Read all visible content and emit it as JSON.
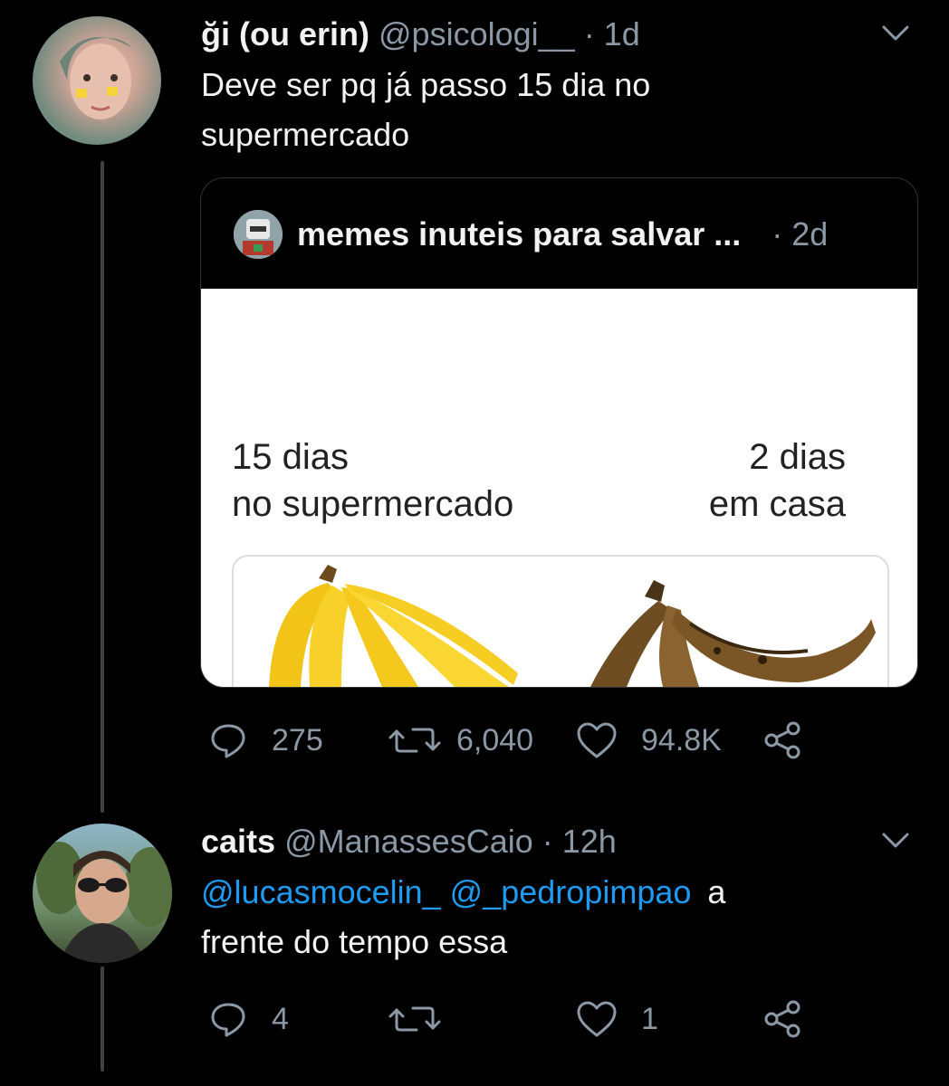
{
  "tweet1": {
    "display_name": "ği (ou erin)",
    "handle": "@psicologi__",
    "time": "· 1d",
    "text_line1": "Deve ser pq já passo 15 dia no",
    "text_line2": "supermercado",
    "quote": {
      "display_name": "memes inuteis para salvar ...",
      "time": "· 2d",
      "meme": {
        "left_line1": "15 dias",
        "left_line2": "no supermercado",
        "right_line1": "2 dias",
        "right_line2": "em casa"
      }
    },
    "actions": {
      "replies": "275",
      "retweets": "6,040",
      "likes": "94.8K"
    }
  },
  "tweet2": {
    "display_name": "caits",
    "handle": "@ManassesCaio",
    "time": "· 12h",
    "mention1": "@lucasmocelin_",
    "mention2": "@_pedropimpao",
    "text_after": "a",
    "text_line2": "frente do tempo essa",
    "actions": {
      "replies": "4",
      "retweets": "",
      "likes": "1"
    }
  },
  "icons": [
    "chevron-down-icon",
    "reply-icon",
    "retweet-icon",
    "like-icon",
    "share-icon"
  ],
  "colors": {
    "background": "#000000",
    "link": "#1d9bf0",
    "muted": "#8b98a5"
  }
}
